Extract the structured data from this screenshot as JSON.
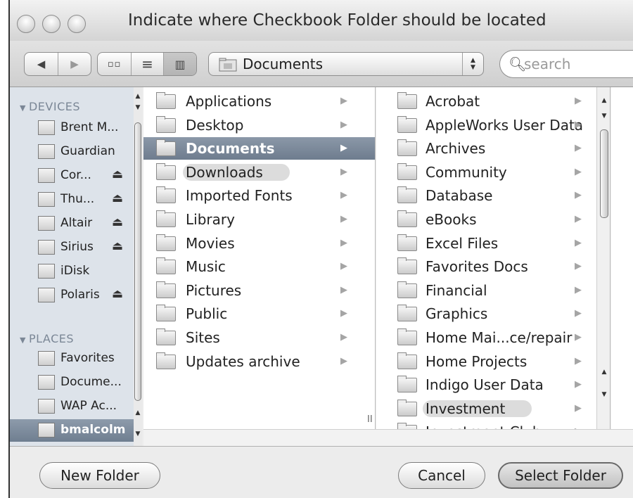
{
  "window": {
    "title": "Indicate where Checkbook Folder should be located"
  },
  "toolbar": {
    "back_icon": "triangle-left-icon",
    "forward_icon": "triangle-right-icon",
    "view_icons": [
      "icon-view-icon",
      "list-view-icon",
      "column-view-icon"
    ],
    "location": "Documents",
    "search_placeholder": "search"
  },
  "sidebar": {
    "devices_label": "DEVICES",
    "places_label": "PLACES",
    "devices": [
      {
        "label": "Brent M...",
        "icon": "computer-icon",
        "eject": false
      },
      {
        "label": "Guardian",
        "icon": "drive-icon",
        "eject": false
      },
      {
        "label": "Cor...",
        "icon": "disk-icon",
        "eject": true
      },
      {
        "label": "Thu...",
        "icon": "disk-icon",
        "eject": true
      },
      {
        "label": "Altair",
        "icon": "disk-icon",
        "eject": true
      },
      {
        "label": "Sirius",
        "icon": "disk-icon",
        "eject": true
      },
      {
        "label": "iDisk",
        "icon": "idisk-icon",
        "eject": false
      },
      {
        "label": "Polaris",
        "icon": "disk-icon",
        "eject": true
      }
    ],
    "places": [
      {
        "label": "Favorites",
        "icon": "heart-icon"
      },
      {
        "label": "Docume...",
        "icon": "document-icon"
      },
      {
        "label": "WAP Ac...",
        "icon": "folder-icon"
      },
      {
        "label": "bmalcolm",
        "icon": "home-icon",
        "selected": true
      }
    ],
    "eject_glyph": "⏏"
  },
  "column1": [
    {
      "label": "Applications"
    },
    {
      "label": "Desktop"
    },
    {
      "label": "Documents",
      "selected": true
    },
    {
      "label": "Downloads",
      "highlight": true
    },
    {
      "label": "Imported Fonts"
    },
    {
      "label": "Library"
    },
    {
      "label": "Movies"
    },
    {
      "label": "Music"
    },
    {
      "label": "Pictures"
    },
    {
      "label": "Public"
    },
    {
      "label": "Sites"
    },
    {
      "label": "Updates archive"
    }
  ],
  "column2": [
    {
      "label": "Acrobat"
    },
    {
      "label": "AppleWorks User Data"
    },
    {
      "label": "Archives"
    },
    {
      "label": "Community"
    },
    {
      "label": "Database"
    },
    {
      "label": "eBooks"
    },
    {
      "label": "Excel Files"
    },
    {
      "label": "Favorites Docs"
    },
    {
      "label": "Financial"
    },
    {
      "label": "Graphics"
    },
    {
      "label": "Home Mai...ce/repair"
    },
    {
      "label": "Home Projects"
    },
    {
      "label": "Indigo User Data"
    },
    {
      "label": "Investment",
      "highlight": true
    },
    {
      "label": "Investment Club"
    }
  ],
  "buttons": {
    "new_folder": "New Folder",
    "cancel": "Cancel",
    "select_folder": "Select Folder"
  }
}
